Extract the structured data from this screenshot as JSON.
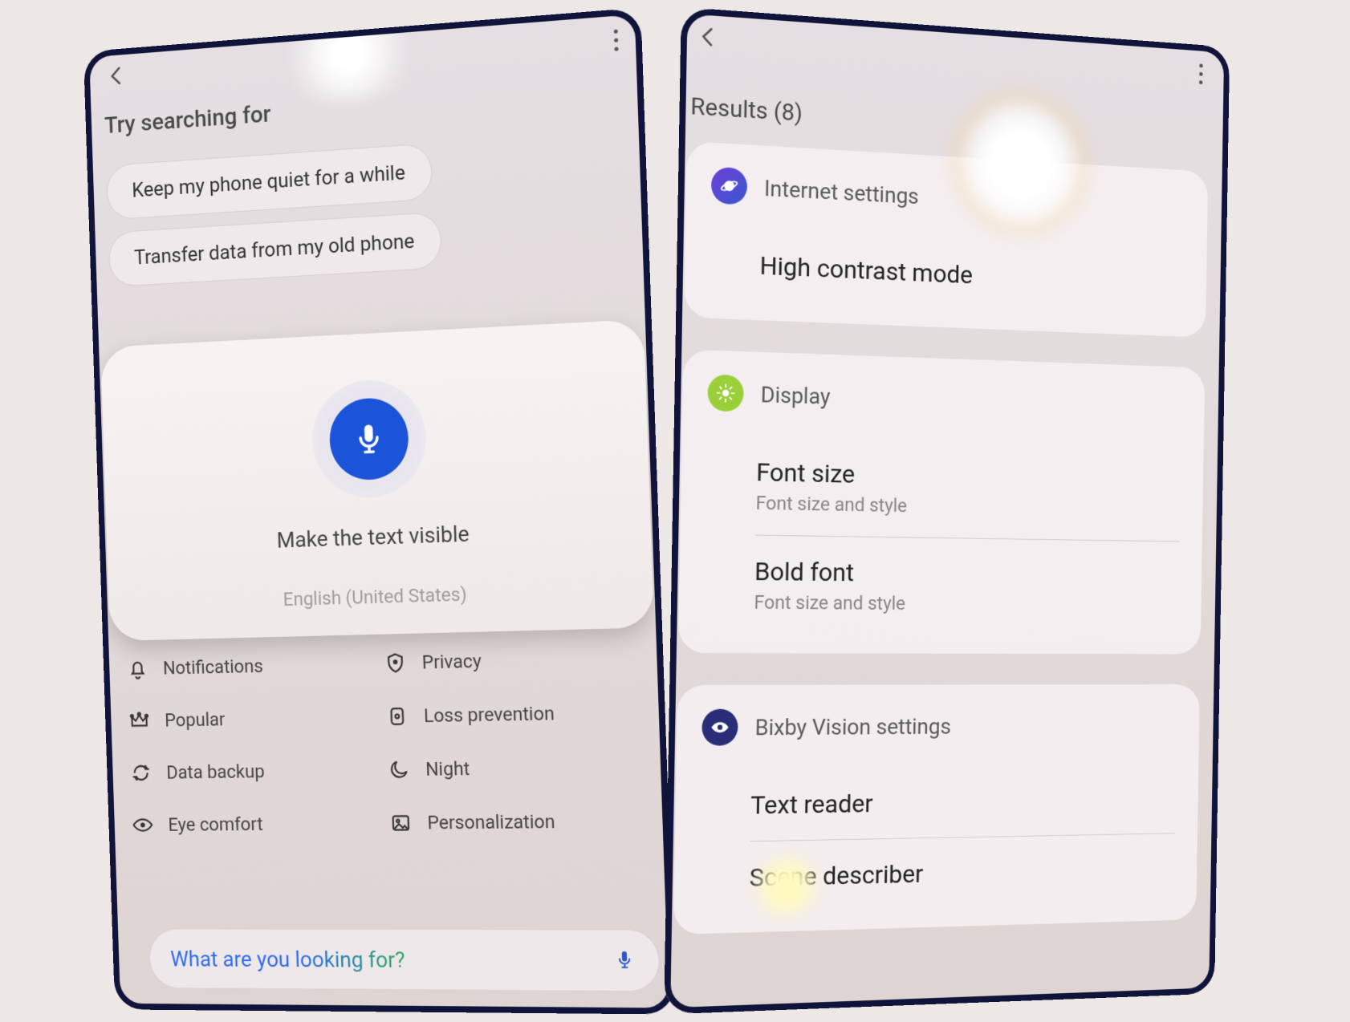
{
  "left": {
    "suggest_header": "Try searching for",
    "chips": [
      "Keep my phone quiet for a while",
      "Transfer data from my old phone"
    ],
    "voice": {
      "transcript": "Make the text visible",
      "language": "English (United States)"
    },
    "quick": [
      {
        "icon": "bell-icon",
        "label": "Notifications"
      },
      {
        "icon": "shield-icon",
        "label": "Privacy"
      },
      {
        "icon": "crown-icon",
        "label": "Popular"
      },
      {
        "icon": "rect-icon",
        "label": "Loss prevention"
      },
      {
        "icon": "sync-icon",
        "label": "Data backup"
      },
      {
        "icon": "moon-icon",
        "label": "Night"
      },
      {
        "icon": "eye-icon",
        "label": "Eye comfort"
      },
      {
        "icon": "image-icon",
        "label": "Personalization"
      }
    ],
    "search_placeholder": "What are you looking for?"
  },
  "right": {
    "results_count": 8,
    "results_label": "Results (8)",
    "groups": [
      {
        "icon": "planet-icon",
        "icon_class": "ai-internet",
        "header": "Internet settings",
        "items": [
          {
            "title": "High contrast mode",
            "sub": ""
          }
        ]
      },
      {
        "icon": "sun-icon",
        "icon_class": "ai-display",
        "header": "Display",
        "items": [
          {
            "title": "Font size",
            "sub": "Font size and style"
          },
          {
            "title": "Bold font",
            "sub": "Font size and style"
          }
        ]
      },
      {
        "icon": "eye-solid-icon",
        "icon_class": "ai-bixby",
        "header": "Bixby Vision settings",
        "items": [
          {
            "title": "Text reader",
            "sub": ""
          },
          {
            "title": "Scene describer",
            "sub": ""
          }
        ]
      }
    ]
  }
}
